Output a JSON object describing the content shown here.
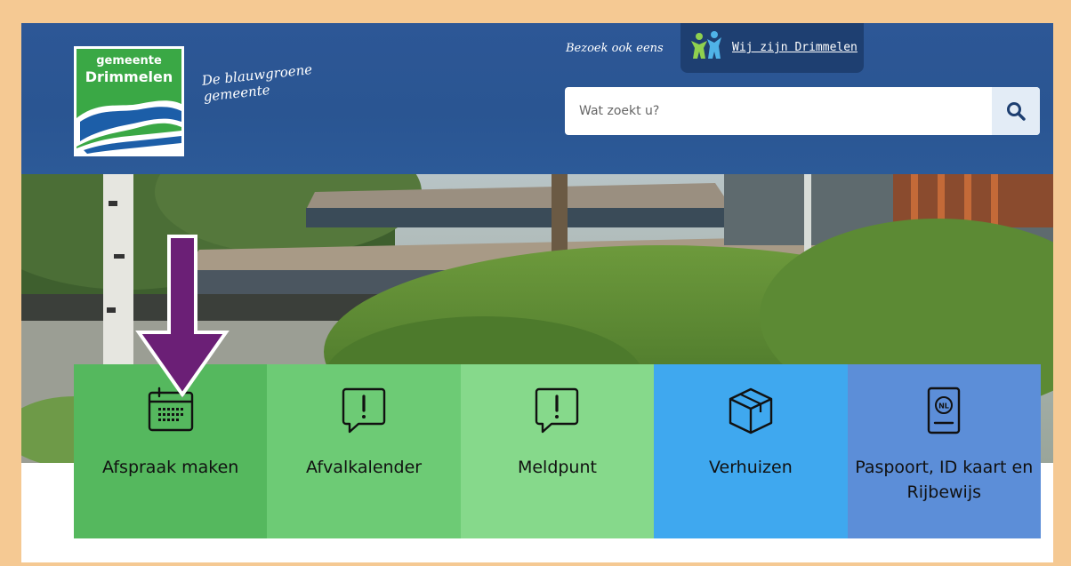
{
  "logo": {
    "line1": "gemeente",
    "line2": "Drimmelen"
  },
  "tagline": {
    "line1": "De blauwgroene",
    "line2": "gemeente"
  },
  "visit": {
    "prefix": "Bezoek ook eens",
    "link": "Wij zijn Drimmelen"
  },
  "search": {
    "placeholder": "Wat zoekt u?"
  },
  "tiles": [
    {
      "label": "Afspraak maken",
      "icon": "calendar-icon"
    },
    {
      "label": "Afvalkalender",
      "icon": "speech-exclamation-icon"
    },
    {
      "label": "Meldpunt",
      "icon": "speech-exclamation-icon"
    },
    {
      "label": "Verhuizen",
      "icon": "box-icon"
    },
    {
      "label": "Paspoort, ID kaart en Rijbewijs",
      "icon": "passport-icon"
    }
  ],
  "colors": {
    "frame": "#f5c993",
    "header": "#2a5592",
    "arrow": "#6b1f76",
    "tile1": "#55b85e",
    "tile2": "#6dcb75",
    "tile3": "#86d98b",
    "tile4": "#3fa8ef",
    "tile5": "#5c8ed8"
  }
}
